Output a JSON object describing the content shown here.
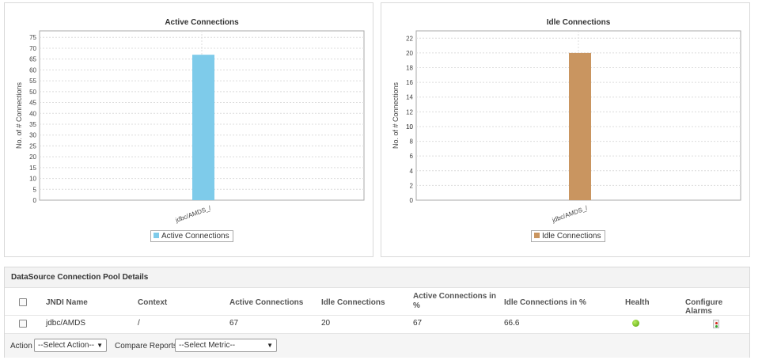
{
  "chart_data": [
    {
      "type": "bar",
      "title": "Active Connections",
      "ylabel": "No. of # Connections",
      "xlabel": "",
      "categories": [
        "jdbc/AMDS_/"
      ],
      "series": [
        {
          "name": "Active Connections",
          "values": [
            67
          ],
          "color": "#7ecbea"
        }
      ],
      "yticks": [
        0,
        5,
        10,
        15,
        20,
        25,
        30,
        35,
        40,
        45,
        50,
        55,
        60,
        65,
        70,
        75
      ],
      "ylim": [
        0,
        78
      ],
      "grid": true,
      "legend": "bottom"
    },
    {
      "type": "bar",
      "title": "Idle Connections",
      "ylabel": "No. of # Connections",
      "xlabel": "",
      "categories": [
        "jdbc/AMDS_/"
      ],
      "series": [
        {
          "name": "Idle Connections",
          "values": [
            20
          ],
          "color": "#c99560"
        }
      ],
      "yticks": [
        0,
        2,
        4,
        6,
        8,
        10,
        10,
        12,
        14,
        16,
        18,
        20,
        22
      ],
      "ylim": [
        0,
        23
      ],
      "grid": true,
      "legend": "bottom"
    }
  ],
  "details": {
    "title": "DataSource Connection Pool Details",
    "columns": [
      "JNDI Name",
      "Context",
      "Active Connections",
      "Idle Connections",
      "Active Connections in %",
      "Idle Connections in %",
      "Health",
      "Configure Alarms"
    ],
    "rows": [
      {
        "jndi": "jdbc/AMDS",
        "context": "/",
        "active": "67",
        "idle": "20",
        "active_pct": "67",
        "idle_pct": "66.6",
        "health": "green-status-icon",
        "alarm": "alarm-config-icon"
      }
    ]
  },
  "actions": {
    "action_label": "Action",
    "action_select": "--Select Action--",
    "compare_label": "Compare Reports",
    "compare_select": "--Select Metric--"
  }
}
